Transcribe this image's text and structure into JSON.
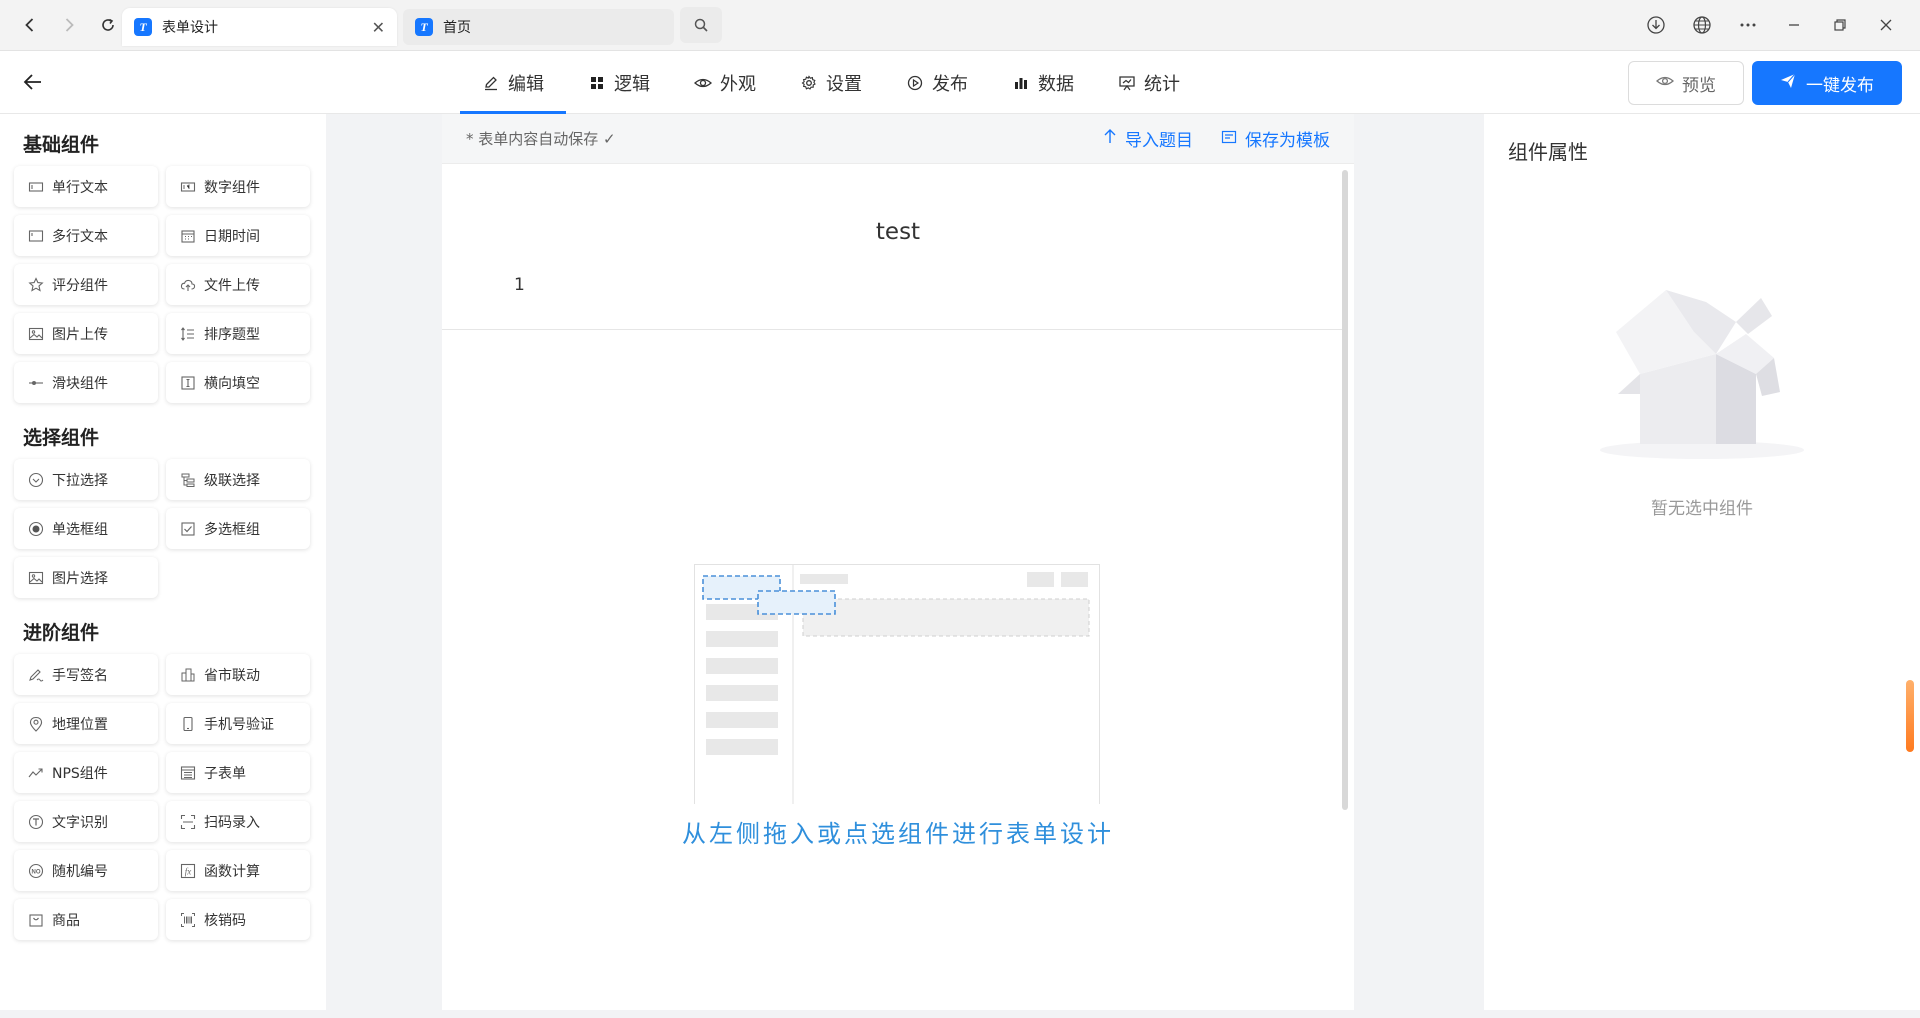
{
  "browser": {
    "tabs": [
      {
        "label": "表单设计",
        "active": true
      },
      {
        "label": "首页",
        "active": false
      }
    ]
  },
  "header": {
    "tabs": [
      {
        "label": "编辑",
        "icon": "edit-icon",
        "active": true
      },
      {
        "label": "逻辑",
        "icon": "grid-icon",
        "active": false
      },
      {
        "label": "外观",
        "icon": "eye-icon",
        "active": false
      },
      {
        "label": "设置",
        "icon": "gear-icon",
        "active": false
      },
      {
        "label": "发布",
        "icon": "play-circle-icon",
        "active": false
      },
      {
        "label": "数据",
        "icon": "bar-chart-icon",
        "active": false
      },
      {
        "label": "统计",
        "icon": "presentation-icon",
        "active": false
      }
    ],
    "preview_label": "预览",
    "publish_label": "一键发布",
    "accent": "#1677ff"
  },
  "sidebar": {
    "groups": [
      {
        "title": "基础组件",
        "items": [
          "单行文本",
          "数字组件",
          "多行文本",
          "日期时间",
          "评分组件",
          "文件上传",
          "图片上传",
          "排序题型",
          "滑块组件",
          "横向填空"
        ]
      },
      {
        "title": "选择组件",
        "items": [
          "下拉选择",
          "级联选择",
          "单选框组",
          "多选框组",
          "图片选择"
        ]
      },
      {
        "title": "进阶组件",
        "items": [
          "手写签名",
          "省市联动",
          "地理位置",
          "手机号验证",
          "NPS组件",
          "子表单",
          "文字识别",
          "扫码录入",
          "随机编号",
          "函数计算",
          "商品",
          "核销码"
        ]
      }
    ]
  },
  "form": {
    "autosave": "* 表单内容自动保存 ✓",
    "import_label": "导入题目",
    "save_template_label": "保存为模板",
    "title": "test",
    "description": "1",
    "placeholder": "从左侧拖入或点选组件进行表单设计"
  },
  "properties": {
    "title": "组件属性",
    "empty_text": "暂无选中组件"
  }
}
